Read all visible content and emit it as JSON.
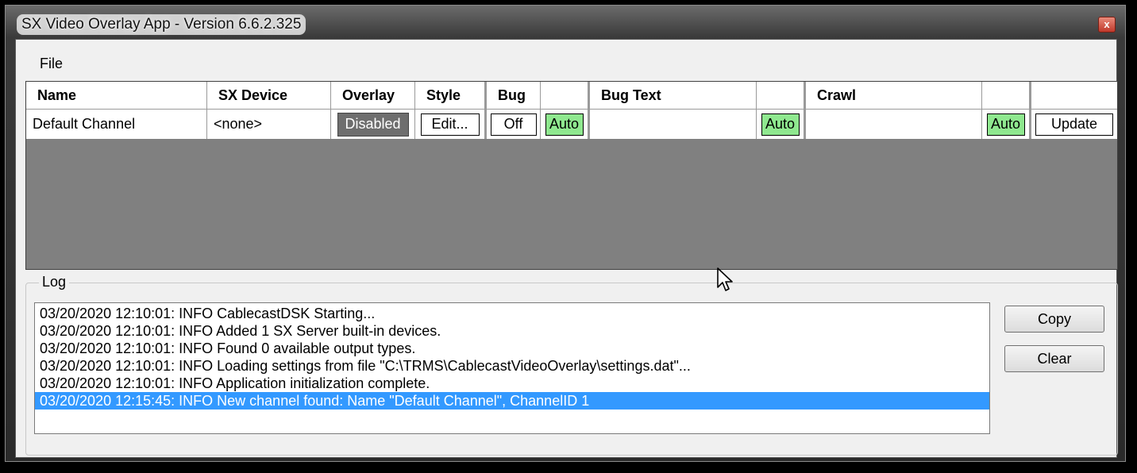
{
  "window": {
    "title": "SX Video Overlay App - Version 6.6.2.325",
    "close_glyph": "x"
  },
  "menu": {
    "file_label": "File"
  },
  "grid": {
    "headers": {
      "name": "Name",
      "sx_device": "SX Device",
      "overlay": "Overlay",
      "style": "Style",
      "bug": "Bug",
      "bug_text": "Bug Text",
      "crawl": "Crawl"
    },
    "rows": [
      {
        "name": "Default Channel",
        "sx_device": "<none>",
        "overlay": "Disabled",
        "style_button": "Edit...",
        "bug_button": "Off",
        "bug_auto": "Auto",
        "bug_text": "",
        "bug_text_auto": "Auto",
        "crawl": "",
        "crawl_auto": "Auto",
        "update_button": "Update"
      }
    ],
    "colors": {
      "auto_green": "#8fe88f",
      "disabled_gray": "#6e6e6e",
      "empty_area": "#808080"
    }
  },
  "log": {
    "legend": "Log",
    "lines": [
      "03/20/2020 12:10:01: INFO  CablecastDSK Starting...",
      "03/20/2020 12:10:01: INFO  Added 1 SX Server built-in devices.",
      "03/20/2020 12:10:01: INFO  Found 0 available output types.",
      "03/20/2020 12:10:01: INFO  Loading settings from file \"C:\\TRMS\\CablecastVideoOverlay\\settings.dat\"...",
      "03/20/2020 12:10:01: INFO  Application initialization complete.",
      "03/20/2020 12:15:45: INFO  New channel found: Name \"Default Channel\", ChannelID 1"
    ],
    "selected_index": 5,
    "selection_color": "#3399ff",
    "copy_label": "Copy",
    "clear_label": "Clear"
  }
}
